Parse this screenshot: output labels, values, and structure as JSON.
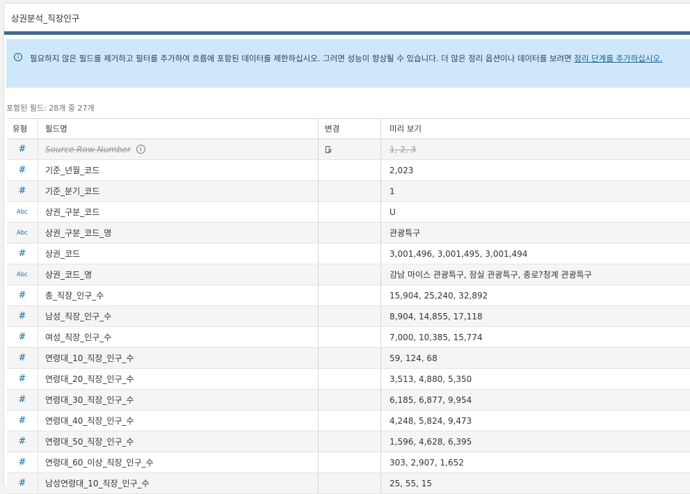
{
  "title": "상권분석_직장인구",
  "banner": {
    "info_glyph": "i",
    "text": "필요하지 않은 필드를 제거하고 필터를 추가하여 흐름에 포함된 데이터를 제한하십시오. 그러면 성능이 향상될 수 있습니다. 더 많은 정리 옵션이나 데이터를 보려면 ",
    "link": "정리 단계를 추가하십시오."
  },
  "field_count": "포함된 필드: 28개 중 27개",
  "columns": {
    "type": "유형",
    "name": "필드명",
    "change": "변경",
    "preview": "미리 보기"
  },
  "info_glyph": "i",
  "rows": [
    {
      "type": "#",
      "name": "Source Row Number",
      "preview": "1, 2, 3"
    },
    {
      "type": "#",
      "name": "기준_년월_코드",
      "preview": "2,023"
    },
    {
      "type": "#",
      "name": "기준_분기_코드",
      "preview": "1"
    },
    {
      "type": "Abc",
      "name": "상권_구분_코드",
      "preview": "U"
    },
    {
      "type": "Abc",
      "name": "상권_구분_코드_명",
      "preview": "관광특구"
    },
    {
      "type": "#",
      "name": "상권_코드",
      "preview": "3,001,496, 3,001,495, 3,001,494"
    },
    {
      "type": "Abc",
      "name": "상권_코드_명",
      "preview": "강남 마이스 관광특구, 잠실 관광특구, 종로?청계 관광특구"
    },
    {
      "type": "#",
      "name": "총_직장_인구_수",
      "preview": "15,904, 25,240, 32,892"
    },
    {
      "type": "#",
      "name": "남성_직장_인구_수",
      "preview": "8,904, 14,855, 17,118"
    },
    {
      "type": "#",
      "name": "여성_직장_인구_수",
      "preview": "7,000, 10,385, 15,774"
    },
    {
      "type": "#",
      "name": "연령대_10_직장_인구_수",
      "preview": "59, 124, 68"
    },
    {
      "type": "#",
      "name": "연령대_20_직장_인구_수",
      "preview": "3,513, 4,880, 5,350"
    },
    {
      "type": "#",
      "name": "연령대_30_직장_인구_수",
      "preview": "6,185, 6,877, 9,954"
    },
    {
      "type": "#",
      "name": "연령대_40_직장_인구_수",
      "preview": "4,248, 5,824, 9,473"
    },
    {
      "type": "#",
      "name": "연령대_50_직장_인구_수",
      "preview": "1,596, 4,628, 6,395"
    },
    {
      "type": "#",
      "name": "연령대_60_이상_직장_인구_수",
      "preview": "303, 2,907, 1,652"
    },
    {
      "type": "#",
      "name": "남성연령대_10_직장_인구_수",
      "preview": "25, 55, 15"
    }
  ],
  "colors": {
    "accent": "#3e6b8a",
    "banner": "#cfe8f9",
    "type_icon": "#1a6fa5"
  }
}
